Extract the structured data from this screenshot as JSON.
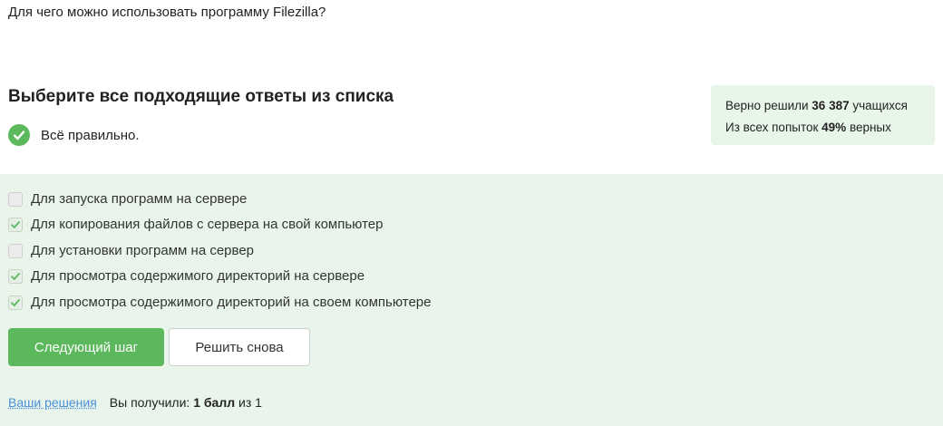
{
  "question": "Для чего можно использовать программу Filezilla?",
  "subtitle": "Выберите все подходящие ответы из списка",
  "result": {
    "icon": "check-circle-icon",
    "text": "Всё правильно."
  },
  "stats": {
    "line1_prefix": "Верно решили ",
    "solvers_count": "36 387",
    "line1_suffix": " учащихся",
    "line2_prefix": "Из всех попыток ",
    "percent_correct": "49%",
    "line2_suffix": " верных"
  },
  "options": [
    {
      "label": "Для запуска программ на сервере",
      "checked": false
    },
    {
      "label": "Для копирования файлов с сервера на свой компьютер",
      "checked": true
    },
    {
      "label": "Для установки программ на сервер",
      "checked": false
    },
    {
      "label": "Для просмотра содержимого директорий на сервере",
      "checked": true
    },
    {
      "label": "Для просмотра содержимого директорий на своем компьютере",
      "checked": true
    }
  ],
  "buttons": {
    "next": "Следующий шаг",
    "retry": "Решить снова"
  },
  "footer": {
    "solutions_link": "Ваши решения",
    "score_prefix": "Вы получили: ",
    "score_value": "1 балл",
    "score_suffix": " из 1"
  },
  "colors": {
    "accent": "#5cb85c",
    "panel_bg": "#e9f5ea",
    "link": "#4a8fd8"
  }
}
